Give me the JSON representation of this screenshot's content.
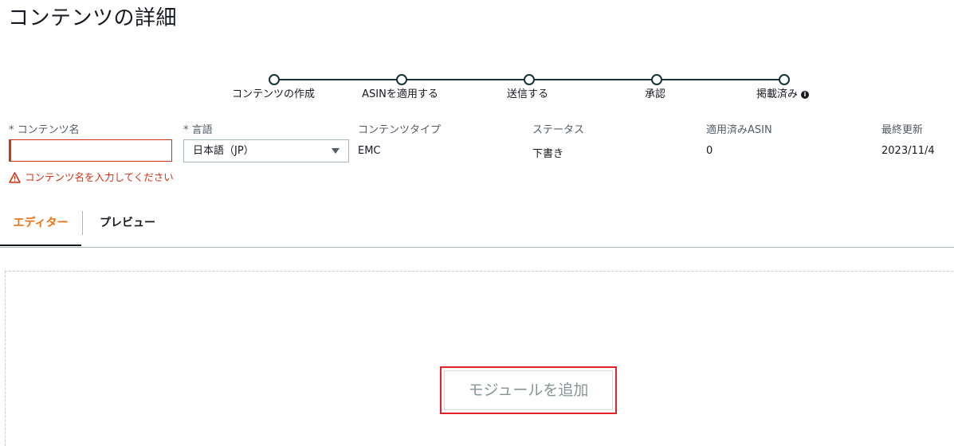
{
  "page": {
    "title": "コンテンツの詳細"
  },
  "stepper": {
    "steps": [
      {
        "label": "コンテンツの作成"
      },
      {
        "label": "ASINを適用する"
      },
      {
        "label": "送信する"
      },
      {
        "label": "承認"
      },
      {
        "label": "掲載済み"
      }
    ],
    "info_icon": "info-icon"
  },
  "fields": {
    "content_name": {
      "label": "* コンテンツ名",
      "value": "",
      "error": "コンテンツ名を入力してください"
    },
    "language": {
      "label": "* 言語",
      "value": "日本語（JP）"
    },
    "content_type": {
      "label": "コンテンツタイプ",
      "value": "EMC"
    },
    "status": {
      "label": "ステータス",
      "value": "下書き"
    },
    "applied_asin": {
      "label": "適用済みASIN",
      "value": "0"
    },
    "last_updated": {
      "label": "最終更新",
      "value": "2023/11/4"
    }
  },
  "tabs": [
    {
      "label": "エディター",
      "active": true
    },
    {
      "label": "プレビュー",
      "active": false
    }
  ],
  "editor": {
    "add_module_label": "モジュールを追加"
  },
  "colors": {
    "accent": "#ec7211",
    "error": "#d13212",
    "stepper": "#16323a",
    "highlight": "#e0232b"
  }
}
